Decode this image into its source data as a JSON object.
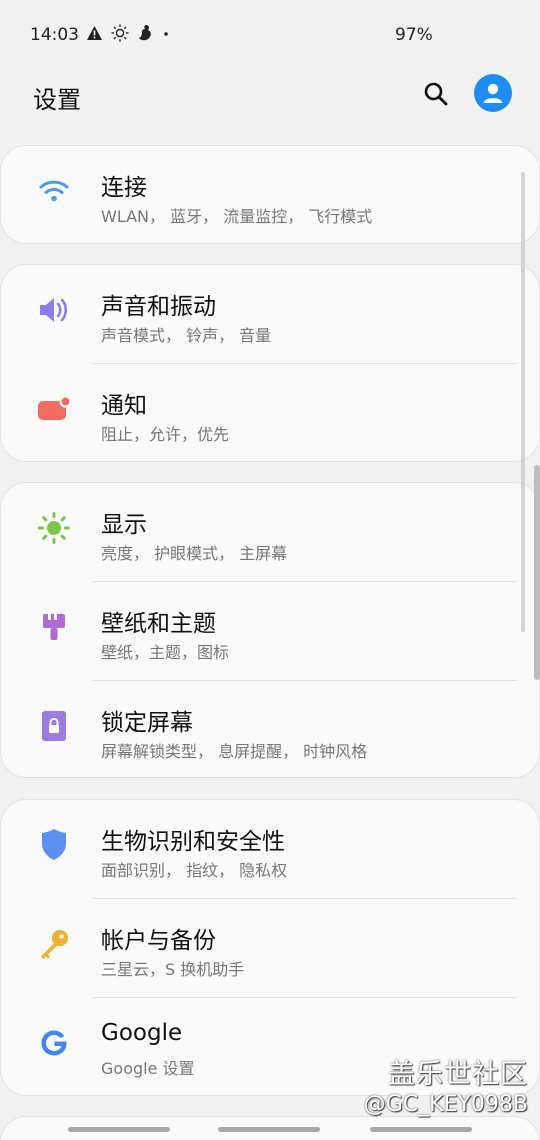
{
  "status_bar": {
    "time": "14:03",
    "battery": "97%",
    "icons": [
      "warning-icon",
      "brightness-icon",
      "bird-icon",
      "dot-icon"
    ]
  },
  "header": {
    "title": "设置",
    "search_icon": "search-icon",
    "account_icon": "account-icon",
    "accent_color": "#1c8df2"
  },
  "items": [
    {
      "title": "连接",
      "subtitle": "WLAN， 蓝牙， 流量监控， 飞行模式",
      "icon": "wifi-icon",
      "color": "#4a9de8"
    },
    {
      "title": "声音和振动",
      "subtitle": "声音模式， 铃声， 音量",
      "icon": "volume-icon",
      "color": "#8b7cf0"
    },
    {
      "title": "通知",
      "subtitle": "阻止，允许，优先",
      "icon": "notification-icon",
      "color": "#f06b62"
    },
    {
      "title": "显示",
      "subtitle": "亮度， 护眼模式， 主屏幕",
      "icon": "sun-icon",
      "color": "#7cc444"
    },
    {
      "title": "壁纸和主题",
      "subtitle": "壁纸，主题，图标",
      "icon": "paintbrush-icon",
      "color": "#b06ad6"
    },
    {
      "title": "锁定屏幕",
      "subtitle": "屏幕解锁类型， 息屏提醒， 时钟风格",
      "icon": "lock-icon",
      "color": "#9b7be0"
    },
    {
      "title": "生物识别和安全性",
      "subtitle": "面部识别， 指纹， 隐私权",
      "icon": "shield-icon",
      "color": "#5b8ff0"
    },
    {
      "title": "帐户与备份",
      "subtitle": "三星云，S 换机助手",
      "icon": "key-icon",
      "color": "#f0b030"
    },
    {
      "title": "Google",
      "subtitle": "Google 设置",
      "icon": "google-icon",
      "color": "#4285f4"
    }
  ],
  "watermark": {
    "line1": "盖乐世社区",
    "line2": "@GC_KEY098B"
  }
}
